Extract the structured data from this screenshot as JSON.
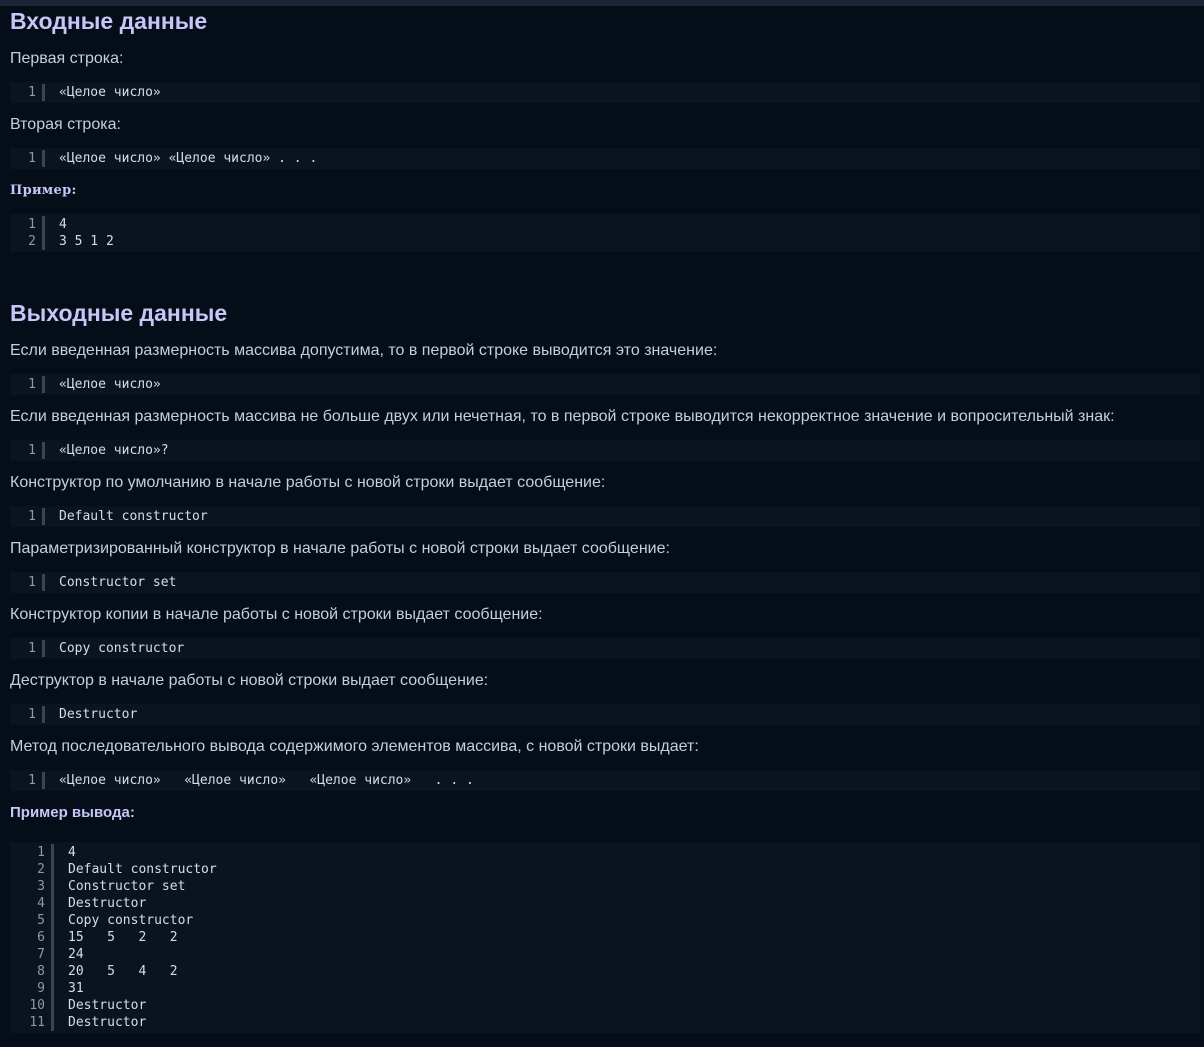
{
  "input_section": {
    "title": "Входные данные",
    "first_line_label": "Первая строка:",
    "first_line_code": [
      {
        "n": "1",
        "text": "«Целое число»"
      }
    ],
    "second_line_label": "Вторая строка:",
    "second_line_code": [
      {
        "n": "1",
        "text": "«Целое число» «Целое число» . . ."
      }
    ],
    "example_label": "Пример:",
    "example_code": [
      {
        "n": "1",
        "text": "4"
      },
      {
        "n": "2",
        "text": "3 5 1 2"
      }
    ]
  },
  "output_section": {
    "title": "Выходные данные",
    "blocks": [
      {
        "label": "Если введенная размерность массива допустима, то в первой строке выводится это значение:",
        "code": [
          {
            "n": "1",
            "text": "«Целое число»"
          }
        ]
      },
      {
        "label": "Если введенная размерность массива не больше двух или нечетная, то в первой строке выводится некорректное значение и вопросительный знак:",
        "code": [
          {
            "n": "1",
            "text": "«Целое число»?"
          }
        ]
      },
      {
        "label": "Конструктор по умолчанию в начале работы с новой строки выдает сообщение:",
        "code": [
          {
            "n": "1",
            "text": "Default constructor"
          }
        ]
      },
      {
        "label": "Параметризированный конструктор в начале работы с новой строки выдает сообщение:",
        "code": [
          {
            "n": "1",
            "text": "Constructor set"
          }
        ]
      },
      {
        "label": "Конструктор копии в начале работы с новой строки выдает сообщение:",
        "code": [
          {
            "n": "1",
            "text": "Copy constructor"
          }
        ]
      },
      {
        "label": "Деструктор в начале работы с новой строки выдает сообщение:",
        "code": [
          {
            "n": "1",
            "text": "Destructor"
          }
        ]
      },
      {
        "label": "Метод последовательного вывода содержимого элементов массива, с новой строки выдает:",
        "code": [
          {
            "n": "1",
            "text": "«Целое число»   «Целое число»   «Целое число»   . . ."
          }
        ]
      }
    ],
    "example_label": "Пример вывода:",
    "example_code": [
      {
        "n": "1",
        "text": "4"
      },
      {
        "n": "2",
        "text": "Default constructor"
      },
      {
        "n": "3",
        "text": "Constructor set"
      },
      {
        "n": "4",
        "text": "Destructor"
      },
      {
        "n": "5",
        "text": "Copy constructor"
      },
      {
        "n": "6",
        "text": "15   5   2   2"
      },
      {
        "n": "7",
        "text": "24"
      },
      {
        "n": "8",
        "text": "20   5   4   2"
      },
      {
        "n": "9",
        "text": "31"
      },
      {
        "n": "10",
        "text": "Destructor"
      },
      {
        "n": "11",
        "text": "Destructor"
      }
    ]
  }
}
